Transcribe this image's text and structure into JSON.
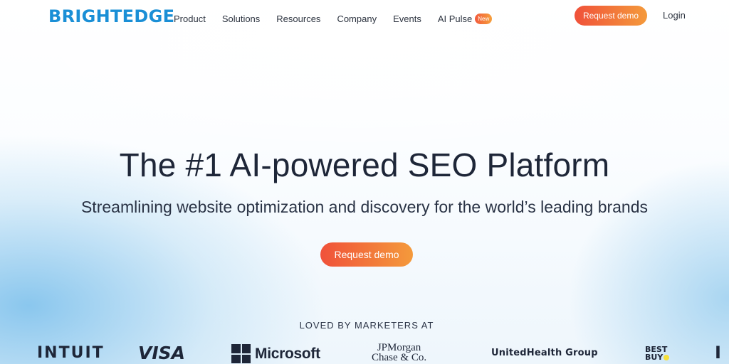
{
  "brand": {
    "logo_text": "BRIGHTEDGE",
    "color": "#1a8fd6"
  },
  "nav": {
    "items": [
      {
        "label": "Product"
      },
      {
        "label": "Solutions"
      },
      {
        "label": "Resources"
      },
      {
        "label": "Company"
      },
      {
        "label": "Events"
      },
      {
        "label": "AI Pulse",
        "badge": "New"
      }
    ],
    "request_demo_label": "Request demo",
    "login_label": "Login"
  },
  "hero": {
    "title": "The #1 AI-powered SEO Platform",
    "subtitle": "Streamlining website optimization and discovery for the world’s leading brands",
    "cta_label": "Request demo",
    "accent_gradient": [
      "#f0513a",
      "#f49a3b"
    ]
  },
  "customers": {
    "heading": "LOVED BY MARKETERS AT",
    "logos": [
      {
        "name": "INTUIT"
      },
      {
        "name": "VISA"
      },
      {
        "name": "Microsoft"
      },
      {
        "name_line1": "JPMorgan",
        "name_line2": "Chase & Co."
      },
      {
        "name": "UnitedHealth Group"
      },
      {
        "name_line1": "BEST",
        "name_line2": "BUY"
      },
      {
        "name": "I"
      }
    ]
  }
}
